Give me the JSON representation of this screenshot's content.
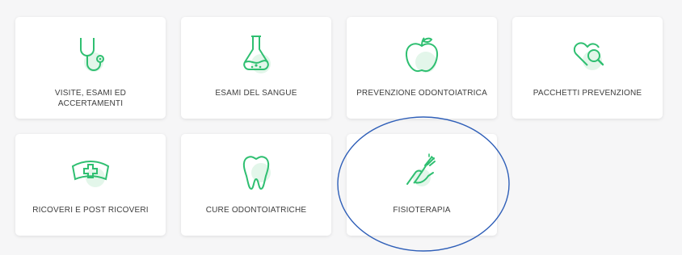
{
  "cards": [
    {
      "label": "VISITE, ESAMI ED ACCERTAMENTI",
      "icon": "stethoscope-icon"
    },
    {
      "label": "ESAMI DEL SANGUE",
      "icon": "lab-flask-icon"
    },
    {
      "label": "PREVENZIONE ODONTOIATRICA",
      "icon": "apple-icon"
    },
    {
      "label": "PACCHETTI PREVENZIONE",
      "icon": "heart-magnifier-icon"
    },
    {
      "label": "RICOVERI E POST RICOVERI",
      "icon": "nurse-cap-icon"
    },
    {
      "label": "CURE ODONTOIATRICHE",
      "icon": "tooth-icon"
    },
    {
      "label": "FISIOTERAPIA",
      "icon": "hand-physio-icon"
    }
  ],
  "colors": {
    "icon_stroke": "#2fbf71",
    "icon_blob": "#e3f6ea",
    "annotation": "#2f5fb8"
  }
}
